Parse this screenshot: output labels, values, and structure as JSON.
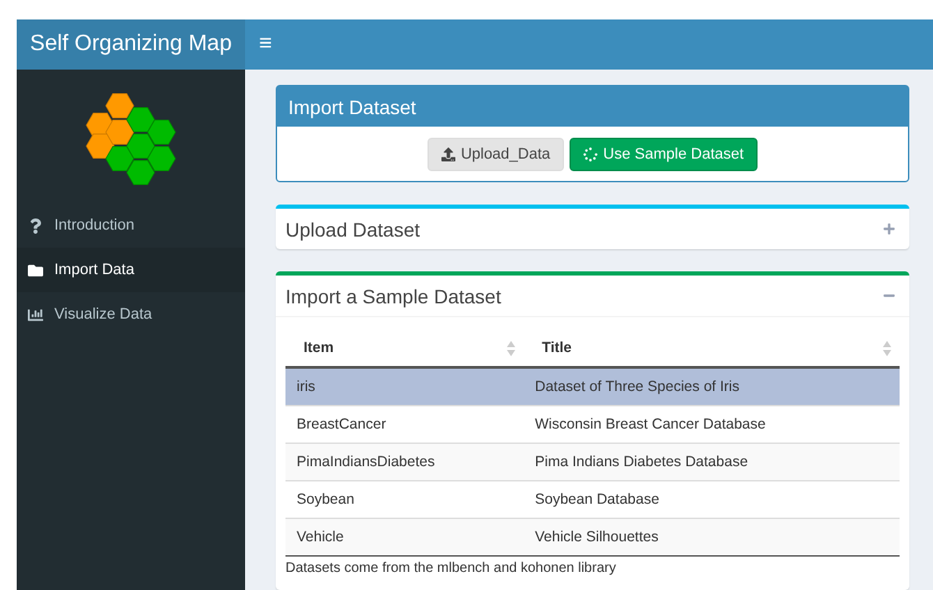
{
  "app": {
    "title": "Self Organizing Map",
    "menu_toggle": "≡"
  },
  "sidebar": {
    "items": [
      {
        "label": "Introduction",
        "selected": false
      },
      {
        "label": "Import Data",
        "selected": true
      },
      {
        "label": "Visualize Data",
        "selected": false
      }
    ]
  },
  "import_box": {
    "title": "Import Dataset",
    "buttons": [
      {
        "label": "Upload_Data",
        "kind": "default"
      },
      {
        "label": "Use Sample Dataset",
        "kind": "success"
      }
    ]
  },
  "panels": [
    {
      "title": "Upload Dataset",
      "expanded": false,
      "color": "#00c0ef"
    },
    {
      "title": "Import a Sample Dataset",
      "expanded": true,
      "color": "#00a65a",
      "table": {
        "columns": [
          "Item",
          "Title"
        ],
        "rows": [
          {
            "cells": [
              "iris",
              "Dataset of Three Species of Iris"
            ],
            "selected": true
          },
          {
            "cells": [
              "BreastCancer",
              "Wisconsin Breast Cancer Database"
            ],
            "selected": false
          },
          {
            "cells": [
              "PimaIndiansDiabetes",
              "Pima Indians Diabetes Database"
            ],
            "selected": false
          },
          {
            "cells": [
              "Soybean",
              "Soybean Database"
            ],
            "selected": false
          },
          {
            "cells": [
              "Vehicle",
              "Vehicle Silhouettes"
            ],
            "selected": false
          }
        ]
      },
      "note": "Datasets come from the mlbench and kohonen library"
    }
  ]
}
